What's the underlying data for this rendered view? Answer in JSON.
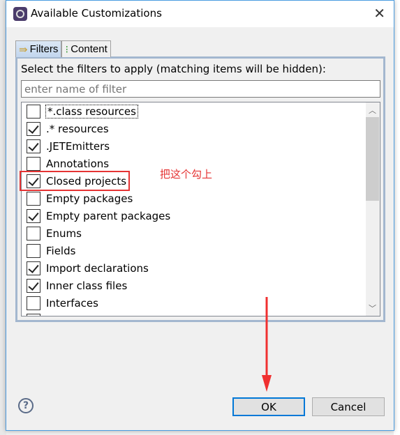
{
  "window": {
    "title": "Available Customizations",
    "close_icon": "close-icon"
  },
  "tabs": [
    {
      "label": "Filters",
      "icon": "filter-icon",
      "active": true
    },
    {
      "label": "Content",
      "icon": "tree-icon",
      "active": false
    }
  ],
  "filters": {
    "instruction": "Select the filters to apply (matching items will be hidden):",
    "search_placeholder": "enter name of filter",
    "items": [
      {
        "label": "*.class resources",
        "checked": false
      },
      {
        "label": ".* resources",
        "checked": true
      },
      {
        "label": ".JETEmitters",
        "checked": true
      },
      {
        "label": "Annotations",
        "checked": false
      },
      {
        "label": "Closed projects",
        "checked": true
      },
      {
        "label": "Empty packages",
        "checked": false
      },
      {
        "label": "Empty parent packages",
        "checked": true
      },
      {
        "label": "Enums",
        "checked": false
      },
      {
        "label": "Fields",
        "checked": false
      },
      {
        "label": "Import declarations",
        "checked": true
      },
      {
        "label": "Inner class files",
        "checked": true
      },
      {
        "label": "Interfaces",
        "checked": false
      }
    ]
  },
  "annotation": {
    "text": "把这个勾上",
    "color": "#e53333"
  },
  "buttons": {
    "ok": "OK",
    "cancel": "Cancel",
    "help": "?"
  }
}
